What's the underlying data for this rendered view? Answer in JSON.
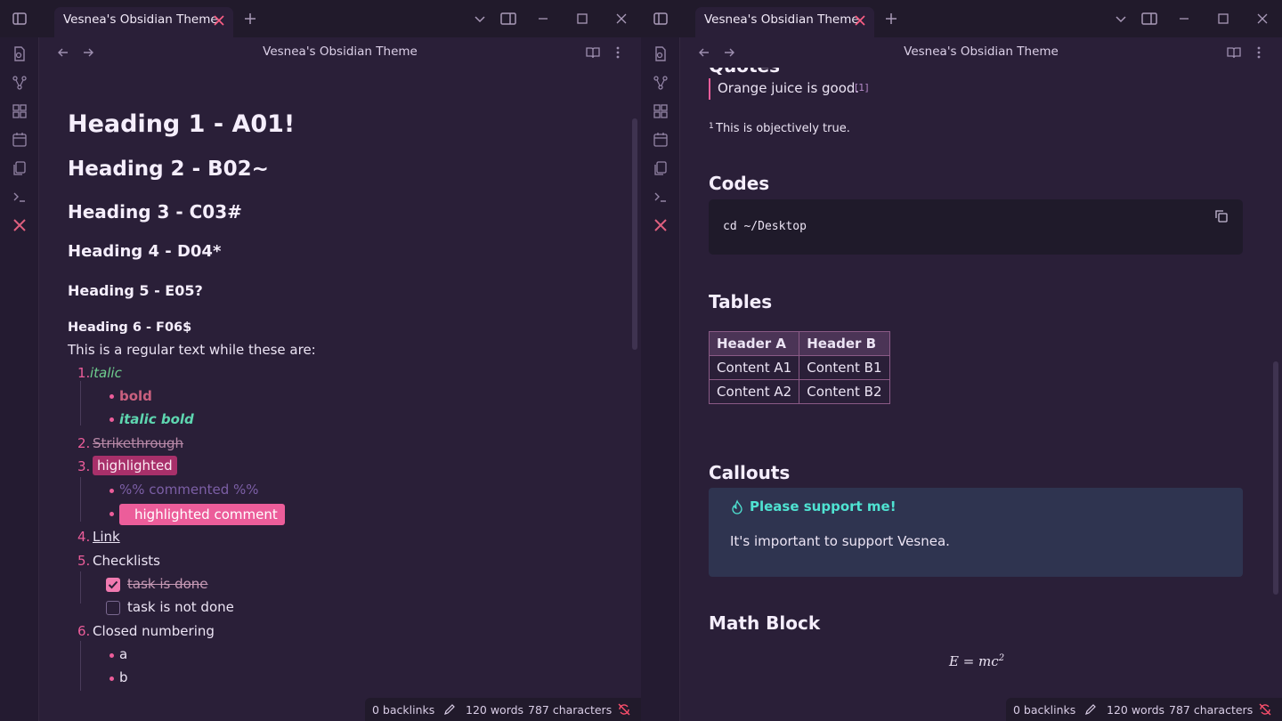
{
  "left": {
    "tab_title": "Vesnea's Obsidian Theme",
    "view_title": "Vesnea's Obsidian Theme",
    "headings": [
      "Heading 1 - A01!",
      "Heading 2 - B02~",
      "Heading 3 - C03#",
      "Heading 4 - D04*",
      "Heading 5 - E05?",
      "Heading 6 - F06$"
    ],
    "intro": "This is a regular text while these are:",
    "list": {
      "n1": "1.",
      "italic": "italic",
      "bold": "bold",
      "italic_bold": "italic bold",
      "n2": "2.",
      "strike": "Strikethrough",
      "n3": "3.",
      "highlighted": "highlighted",
      "commented": "%% commented %%",
      "highlighted_comment": "highlighted comment",
      "n4": "4.",
      "link": "Link",
      "n5": "5.",
      "checklists": "Checklists",
      "task_done": "task is done",
      "task_not_done": "task is not done",
      "n6": "6.",
      "closed_numbering": "Closed numbering",
      "a": "a",
      "b": "b"
    },
    "status": {
      "backlinks": "0 backlinks",
      "words": "120 words",
      "characters": "787 characters"
    }
  },
  "right": {
    "tab_title": "Vesnea's Obsidian Theme",
    "view_title": "Vesnea's Obsidian Theme",
    "quotes_heading_partial": "Quotes",
    "quote": "Orange juice is good.",
    "footnote_ref": "[1]",
    "footnote_mark": "1",
    "footnote_text": "This is objectively true.",
    "codes_heading": "Codes",
    "code": "cd ~/Desktop",
    "tables_heading": "Tables",
    "table": {
      "headers": [
        "Header A",
        "Header B"
      ],
      "rows": [
        [
          "Content A1",
          "Content B1"
        ],
        [
          "Content A2",
          "Content B2"
        ]
      ]
    },
    "callouts_heading": "Callouts",
    "callout_title": "Please support me!",
    "callout_body": "It's important to support Vesnea.",
    "math_heading": "Math Block",
    "math": "E = mc",
    "math_exp": "2",
    "status": {
      "backlinks": "0 backlinks",
      "words": "120 words",
      "characters": "787 characters"
    }
  },
  "colors": {
    "background": "#2a1f38",
    "titlebar": "#211a2b",
    "accent_pink": "#ec5d9a",
    "italic_green": "#6fcf8f",
    "bold_rose": "#c9607e",
    "italic_bold_teal": "#5ed6b0",
    "highlight": "#a8306a",
    "callout_title": "#4fe3d2",
    "callout_bg": "#2f3450",
    "code_bg": "#1f1a2a"
  },
  "icons": [
    "sidebar-toggle-icon",
    "close-icon",
    "plus-icon",
    "chevron-down-icon",
    "split-view-icon",
    "minimize-icon",
    "maximize-icon",
    "file-search-icon",
    "graph-icon",
    "grid-icon",
    "calendar-icon",
    "copy-icon",
    "terminal-icon",
    "tools-icon",
    "arrow-left-icon",
    "arrow-right-icon",
    "book-icon",
    "more-vertical-icon",
    "pencil-icon",
    "sync-off-icon",
    "flame-icon"
  ]
}
